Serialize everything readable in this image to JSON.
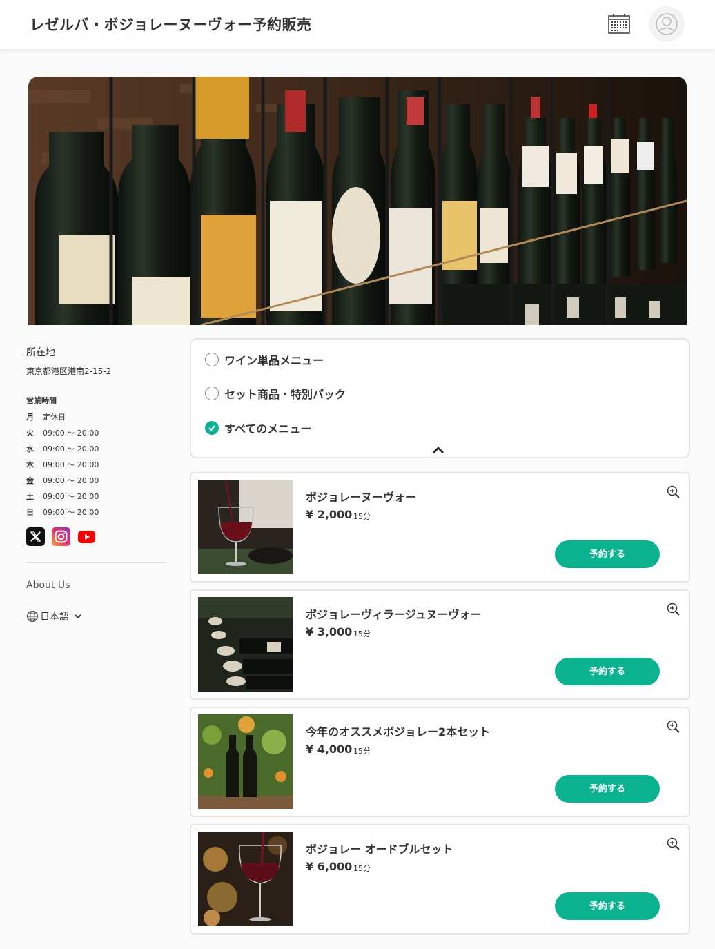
{
  "header": {
    "title": "レゼルバ・ボジョレーヌーヴォー予約販売",
    "calendar_icon": "calendar-icon",
    "user_icon": "user-avatar-icon"
  },
  "sidebar": {
    "location_label": "所在地",
    "address": "東京都港区港南2-15-2",
    "hours_label": "営業時間",
    "hours": [
      {
        "day": "月",
        "time": "定休日"
      },
      {
        "day": "火",
        "time": "09:00 〜 20:00"
      },
      {
        "day": "水",
        "time": "09:00 〜 20:00"
      },
      {
        "day": "木",
        "time": "09:00 〜 20:00"
      },
      {
        "day": "金",
        "time": "09:00 〜 20:00"
      },
      {
        "day": "土",
        "time": "09:00 〜 20:00"
      },
      {
        "day": "日",
        "time": "09:00 〜 20:00"
      }
    ],
    "social": [
      "x-icon",
      "instagram-icon",
      "youtube-icon"
    ],
    "about": "About Us",
    "language": "日本語"
  },
  "filter": {
    "options": [
      {
        "label": "ワイン単品メニュー",
        "checked": false
      },
      {
        "label": "セット商品・特別パック",
        "checked": false
      },
      {
        "label": "すべてのメニュー",
        "checked": true
      }
    ]
  },
  "menu": {
    "reserve_label": "予約する",
    "items": [
      {
        "name": "ボジョレーヌーヴォー",
        "price": "¥ 2,000",
        "duration": "15分"
      },
      {
        "name": "ボジョレーヴィラージュヌーヴォー",
        "price": "¥ 3,000",
        "duration": "15分"
      },
      {
        "name": "今年のオススメボジョレー2本セット",
        "price": "¥ 4,000",
        "duration": "15分"
      },
      {
        "name": "ボジョレー オードブルセット",
        "price": "¥ 6,000",
        "duration": "15分"
      }
    ]
  },
  "colors": {
    "accent": "#0bb28f",
    "border": "#e6e6e6"
  }
}
